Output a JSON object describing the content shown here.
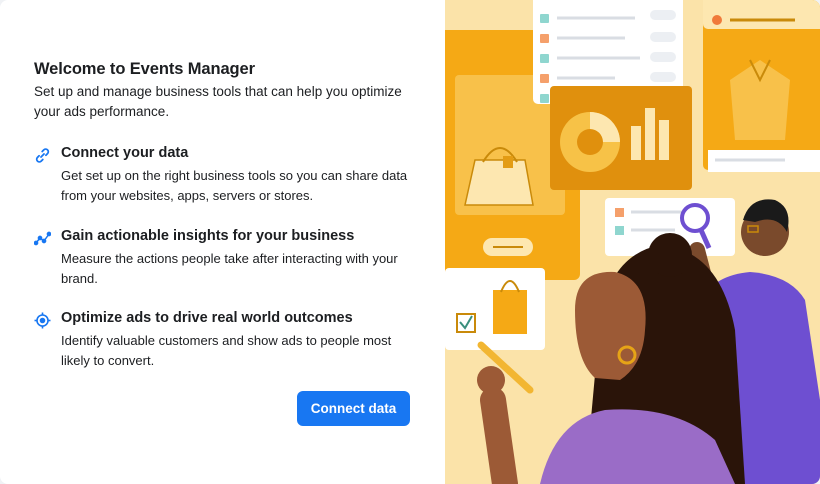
{
  "dialog": {
    "title": "Welcome to Events Manager",
    "subtitle": "Set up and manage business tools that can help you optimize your ads performance."
  },
  "features": [
    {
      "icon": "link-icon",
      "title": "Connect your data",
      "description": "Get set up on the right business tools so you can share data from your websites, apps, servers or stores."
    },
    {
      "icon": "trend-line-icon",
      "title": "Gain actionable insights for your business",
      "description": "Measure the actions people take after interacting with your brand."
    },
    {
      "icon": "target-icon",
      "title": "Optimize ads to drive real world outcomes",
      "description": "Identify valuable customers and show ads to people most likely to convert."
    }
  ],
  "actions": {
    "primary_label": "Connect data"
  },
  "colors": {
    "accent": "#1877f2",
    "illustration_bg": "#fbe3a9",
    "illustration_panel": "#f5a915"
  }
}
